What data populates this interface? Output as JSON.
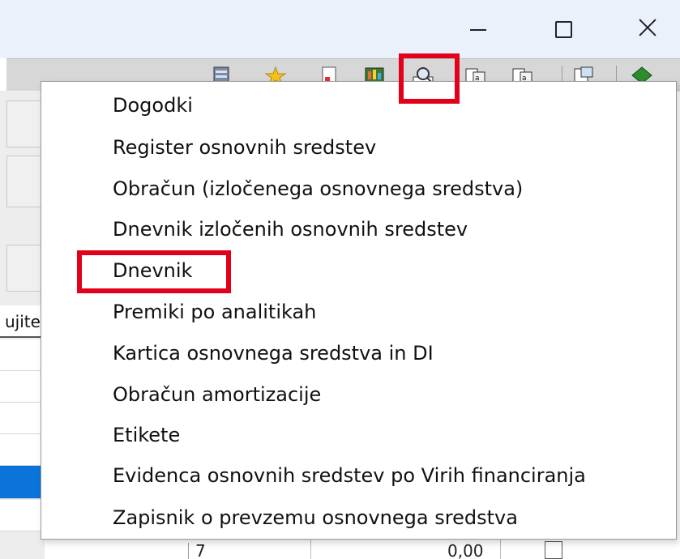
{
  "window_controls": {
    "minimize": "minimize",
    "maximize": "maximize",
    "close": "close"
  },
  "left_panel": {
    "column_header": "ujite",
    "selected_row_color": "#0a74da"
  },
  "menu": {
    "items": [
      "Dogodki",
      "Register osnovnih sredstev",
      "Obračun (izločenega osnovnega sredstva)",
      "Dnevnik izločenih osnovnih sredstev",
      "Dnevnik",
      "Premiki po analitikah",
      "Kartica osnovnega sredstva in DI",
      "Obračun amortizacije",
      "Etikete",
      "Evidenca osnovnih sredstev po Virih financiranja",
      "Zapisnik o prevzemu osnovnega sredstva"
    ]
  },
  "bottom_row": {
    "number": "7",
    "value": "0,00"
  },
  "highlight_color": "#e3001b"
}
